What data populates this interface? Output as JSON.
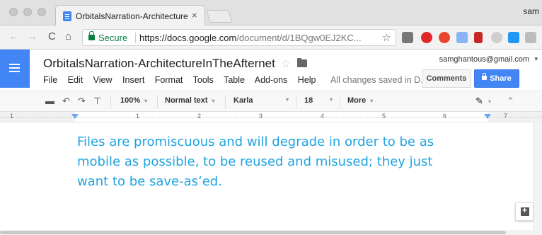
{
  "browser": {
    "tab_title": "OrbitalsNarration-Architecture",
    "tab_close": "×",
    "user_name": "sam",
    "url_secure_label": "Secure",
    "url_scheme": "https://",
    "url_host": "docs.google.com",
    "url_path": "/document/d/1BQgw0EJ2KC...",
    "nav": {
      "back": "←",
      "forward": "→",
      "reload": "C",
      "home": "⌂"
    },
    "bookmark_icon": "☆",
    "extensions": [
      "extension-icon",
      "pinterest-icon",
      "opera-icon",
      "docs-icon",
      "bars-icon",
      "cloud-icon",
      "arrow-icon",
      "camera-icon"
    ],
    "menu_icon": "⋮"
  },
  "docs": {
    "doc_title": "OrbitalsNarration-ArchitectureInTheAfternet",
    "title_star": "☆",
    "menu": [
      "File",
      "Edit",
      "View",
      "Insert",
      "Format",
      "Tools",
      "Table",
      "Add-ons",
      "Help"
    ],
    "save_status": "All changes saved in D...",
    "account_email": "samghantous@gmail.com",
    "account_caret": "▾",
    "comments_label": "Comments",
    "share_label": "Share"
  },
  "toolbar": {
    "zoom": "100%",
    "style": "Normal text",
    "font": "Karla",
    "size": "18",
    "more": "More",
    "caret": "▾",
    "collapse": "⌃"
  },
  "ruler": {
    "numbers": [
      "1",
      "1",
      "2",
      "3",
      "4",
      "5",
      "6",
      "7"
    ]
  },
  "document": {
    "line1": "Files are promiscuous and will degrade in order to be as",
    "line2": "mobile as possible, to be reused and misused; they just",
    "line3": "want to be save-as’ed."
  },
  "colors": {
    "accent": "#4285f4",
    "doc_text": "#1fa4e0",
    "secure": "#0b8043"
  }
}
